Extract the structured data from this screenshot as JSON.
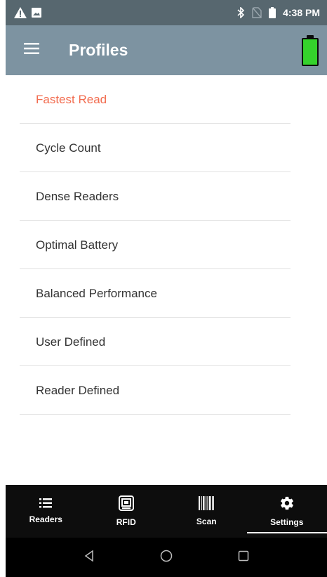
{
  "status_bar": {
    "time": "4:38 PM",
    "icons": [
      "warning-icon",
      "image-notification-icon",
      "bluetooth-icon",
      "no-sim-icon",
      "battery-status-icon"
    ]
  },
  "app_bar": {
    "title": "Profiles",
    "menu_icon": "hamburger-menu-icon",
    "battery_icon": "battery-full-icon",
    "battery_color": "#35d22c"
  },
  "profiles": {
    "selected_color": "#f26c4f",
    "items": [
      {
        "label": "Fastest Read",
        "selected": true
      },
      {
        "label": "Cycle Count",
        "selected": false
      },
      {
        "label": "Dense Readers",
        "selected": false
      },
      {
        "label": "Optimal Battery",
        "selected": false
      },
      {
        "label": "Balanced Performance",
        "selected": false
      },
      {
        "label": "User Defined",
        "selected": false
      },
      {
        "label": "Reader Defined",
        "selected": false
      }
    ]
  },
  "bottom_nav": {
    "tabs": [
      {
        "label": "Readers",
        "icon": "list-icon",
        "active": false
      },
      {
        "label": "RFID",
        "icon": "rfid-icon",
        "active": false
      },
      {
        "label": "Scan",
        "icon": "barcode-icon",
        "active": false
      },
      {
        "label": "Settings",
        "icon": "gear-icon",
        "active": true
      }
    ]
  },
  "system_nav": {
    "buttons": [
      "back-icon",
      "home-icon",
      "recents-icon"
    ]
  }
}
